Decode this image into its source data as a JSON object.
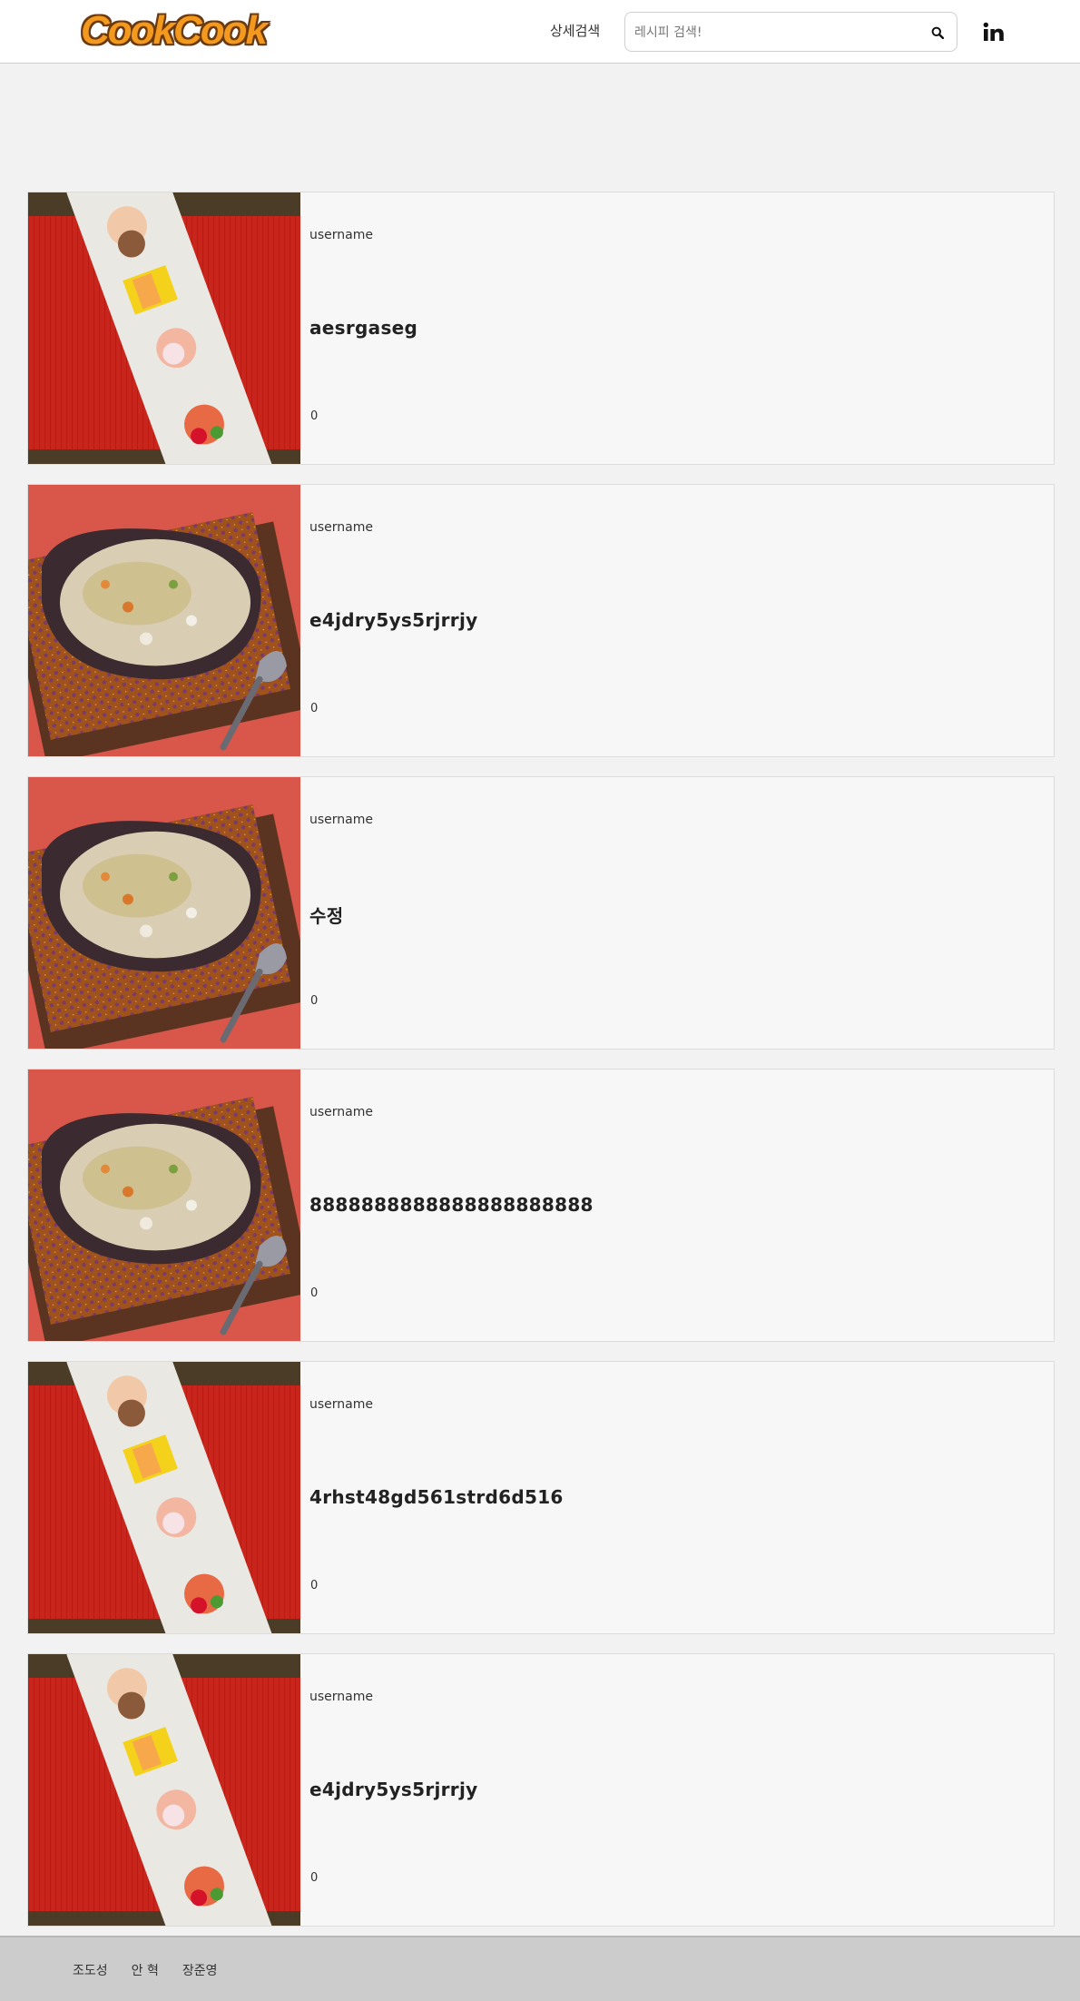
{
  "header": {
    "logo": "CookCook",
    "detail_search_label": "상세검색",
    "search_placeholder": "레시피 검색!",
    "search_icon": "search-icon",
    "social_icon": "linkedin-icon"
  },
  "recipes": [
    {
      "username": "username",
      "title": "aesrgaseg",
      "count": "0",
      "image": "shrimp-platter"
    },
    {
      "username": "username",
      "title": "e4jdry5ys5rjrrjy",
      "count": "0",
      "image": "porridge-bowl"
    },
    {
      "username": "username",
      "title": "수정",
      "count": "0",
      "image": "porridge-bowl"
    },
    {
      "username": "username",
      "title": "8888888888888888888888",
      "count": "0",
      "image": "porridge-bowl"
    },
    {
      "username": "username",
      "title": "4rhst48gd561strd6d516",
      "count": "0",
      "image": "shrimp-platter"
    },
    {
      "username": "username",
      "title": "e4jdry5ys5rjrrjy",
      "count": "0",
      "image": "shrimp-platter"
    }
  ],
  "footer": {
    "names": [
      "조도성",
      "안 혁",
      "장준영"
    ]
  }
}
